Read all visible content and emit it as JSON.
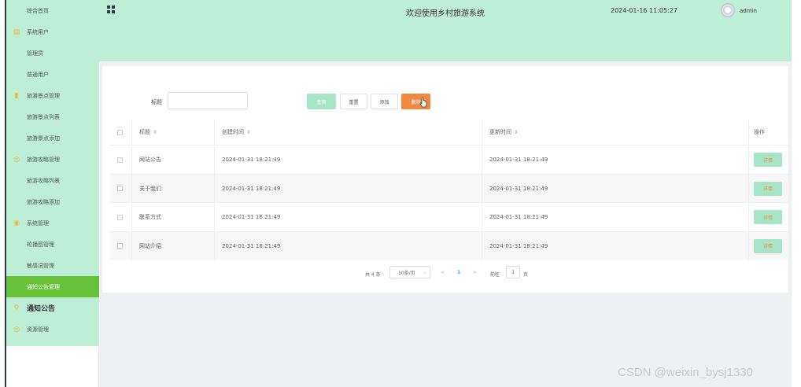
{
  "header": {
    "title": "欢迎使用乡村旅游系统",
    "datetime": "2024-01-16 11:05:27",
    "username": "admin"
  },
  "sidebar": {
    "items": [
      {
        "label": "综合首页",
        "level": "child"
      },
      {
        "label": "系统用户",
        "level": "parent",
        "icon": "user-doc-icon"
      },
      {
        "label": "管理员",
        "level": "child"
      },
      {
        "label": "普通用户",
        "level": "child"
      },
      {
        "label": "旅游景点管理",
        "level": "parent",
        "icon": "bar-chart-icon"
      },
      {
        "label": "旅游景点列表",
        "level": "child"
      },
      {
        "label": "旅游景点添加",
        "level": "child"
      },
      {
        "label": "旅游攻略管理",
        "level": "parent",
        "icon": "comment-icon"
      },
      {
        "label": "旅游攻略列表",
        "level": "child"
      },
      {
        "label": "旅游攻略添加",
        "level": "child"
      },
      {
        "label": "系统管理",
        "level": "parent",
        "icon": "check-circle-icon"
      },
      {
        "label": "轮播图管理",
        "level": "child"
      },
      {
        "label": "敏感词管理",
        "level": "child"
      },
      {
        "label": "通知公告管理",
        "level": "child",
        "active": true
      },
      {
        "label": "通知公告",
        "level": "parent",
        "icon": "location-pin-icon",
        "bold": true
      },
      {
        "label": "资源管理",
        "level": "parent",
        "icon": "comment-icon"
      }
    ]
  },
  "search": {
    "label": "标题",
    "value": "",
    "placeholder": ""
  },
  "toolbar": {
    "query_label": "查询",
    "reset_label": "重置",
    "add_label": "添加",
    "delete_label": "删除"
  },
  "table": {
    "columns": {
      "title": "标题",
      "created": "创建时间",
      "updated": "更新时间",
      "ops": "操作"
    },
    "rows": [
      {
        "title": "网站公告",
        "created": "2024-01-31 18:21:49",
        "updated": "2024-01-31 18:21:49",
        "action": "详情"
      },
      {
        "title": "关于我们",
        "created": "2024-01-31 18:21:49",
        "updated": "2024-01-31 18:21:49",
        "action": "详情"
      },
      {
        "title": "联系方式",
        "created": "2024-01-31 18:21:49",
        "updated": "2024-01-31 18:21:49",
        "action": "详情"
      },
      {
        "title": "网站介绍",
        "created": "2024-01-31 18:21:49",
        "updated": "2024-01-31 18:21:49",
        "action": "详情"
      }
    ]
  },
  "pager": {
    "total": "共 4 条",
    "page_size": "10条/页",
    "prev": "<",
    "current": "1",
    "next": ">",
    "goto": "前往",
    "goto_value": "1",
    "page_unit": "页"
  },
  "watermark": "CSDN @weixin_bysj1330",
  "colors": {
    "sidebar_bg": "#bfeed6",
    "active_item": "#67c23a",
    "query_button": "#a8e5c8",
    "delete_button": "#f1883f",
    "detail_text": "#e29145"
  }
}
